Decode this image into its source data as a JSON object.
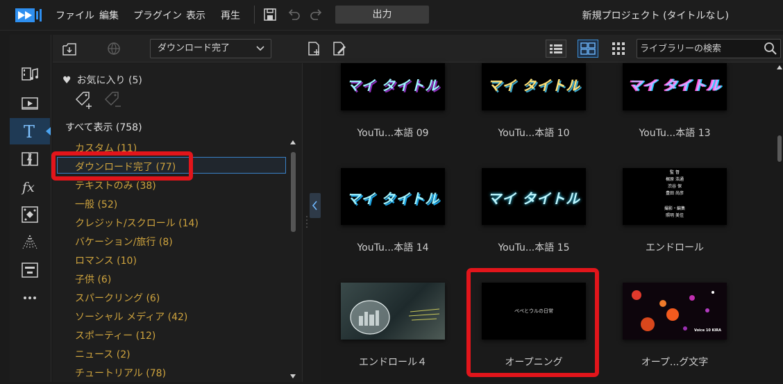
{
  "menubar": {
    "items": [
      "ファイル",
      "編集",
      "プラグイン",
      "表示",
      "再生"
    ],
    "output_label": "出力",
    "project_title": "新規プロジェクト (タイトルなし)"
  },
  "rail": {
    "icons": [
      "media-room-icon",
      "video-fx-icon",
      "title-icon",
      "transition-icon",
      "fx-icon",
      "particle-icon",
      "light-ray-icon",
      "subtitle-icon",
      "more-icon"
    ],
    "active": "title-icon"
  },
  "library_bar": {
    "dropdown_value": "ダウンロード完了",
    "search_placeholder": "ライブラリーの検索",
    "view_mode": "grid"
  },
  "categories": {
    "favorites": "お気に入り (5)",
    "show_all": "すべて表示 (758)",
    "items": [
      "カスタム (11)",
      "ダウンロード完了 (77)",
      "テキストのみ (38)",
      "一般 (52)",
      "クレジット/スクロール (14)",
      "バケーション/旅行 (8)",
      "ロマンス (10)",
      "子供 (6)",
      "スパークリング (6)",
      "ソーシャル メディア (42)",
      "スポーティー (12)",
      "ニュース (2)",
      "チュートリアル (78)"
    ],
    "selected_index": 1
  },
  "tiles": [
    {
      "label": "YouTu...本語 09",
      "thumb_text": "マイ タイトル",
      "thumb_color": "#9ff3ff"
    },
    {
      "label": "YouTu...本語 10",
      "thumb_text": "マイ タイトル",
      "thumb_color": "#ffe27a"
    },
    {
      "label": "YouTu...本語 13",
      "thumb_text": "マイ タイトル",
      "thumb_color": "#d9a6ff"
    },
    {
      "label": "YouTu...本語 14",
      "thumb_text": "マイ タイトル",
      "thumb_color": "#9ff3ff"
    },
    {
      "label": "YouTu...本語 15",
      "thumb_text": "マイ タイトル",
      "thumb_color": "#bff7ff"
    },
    {
      "label": "エンドロール",
      "thumb_text": ""
    },
    {
      "label": "エンドロール４",
      "thumb_text": ""
    },
    {
      "label": "オープニング",
      "thumb_text": "ペペとウルの日常"
    },
    {
      "label": "オープ...グ文字",
      "thumb_text": "Voice 10 KIRA"
    }
  ],
  "credit_lines": [
    "監 督",
    "梶原 浩通",
    "渋谷 保",
    "豊田 尚彦",
    "撮影・編集",
    "",
    "照明 美佳"
  ],
  "colors": {
    "accent": "#3d8fd6",
    "category_text": "#cfa43e",
    "highlight_red": "#e2151b"
  }
}
